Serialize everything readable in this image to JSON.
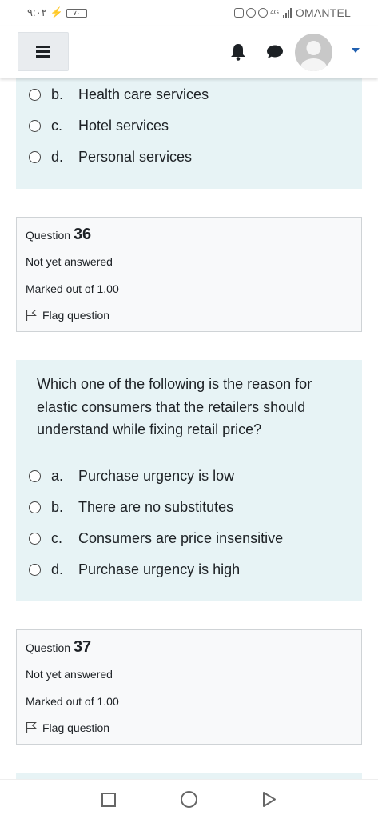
{
  "status_bar": {
    "time": "٩:٠٢",
    "battery": "٧٠",
    "network": "4G",
    "carrier": "OMANTEL"
  },
  "header": {
    "menu_icon": "hamburger-icon",
    "notification_icon": "bell-icon",
    "messages_icon": "chat-bubble-icon",
    "user_menu_icon": "caret-down-icon"
  },
  "question_35": {
    "answers": [
      {
        "letter": "b.",
        "text": "Health care services"
      },
      {
        "letter": "c.",
        "text": "Hotel services"
      },
      {
        "letter": "d.",
        "text": "Personal services"
      }
    ]
  },
  "question_36": {
    "label": "Question",
    "number": "36",
    "state": "Not yet answered",
    "grade": "Marked out of 1.00",
    "flag_label": "Flag question",
    "text": "Which one of the following is the reason for elastic consumers that the retailers should understand while fixing retail price?",
    "answers": [
      {
        "letter": "a.",
        "text": "Purchase urgency is low"
      },
      {
        "letter": "b.",
        "text": "There are no substitutes"
      },
      {
        "letter": "c.",
        "text": "Consumers are price insensitive"
      },
      {
        "letter": "d.",
        "text": "Purchase urgency is high"
      }
    ]
  },
  "question_37": {
    "label": "Question",
    "number": "37",
    "state": "Not yet answered",
    "grade": "Marked out of 1.00",
    "flag_label": "Flag question"
  },
  "nav_bar": {
    "recents_icon": "square-icon",
    "home_icon": "circle-icon",
    "back_icon": "triangle-back-icon"
  },
  "colors": {
    "info_panel": "#e7f3f5",
    "qinfo_panel": "#f8f9fa",
    "accent": "#1f5fb0"
  }
}
